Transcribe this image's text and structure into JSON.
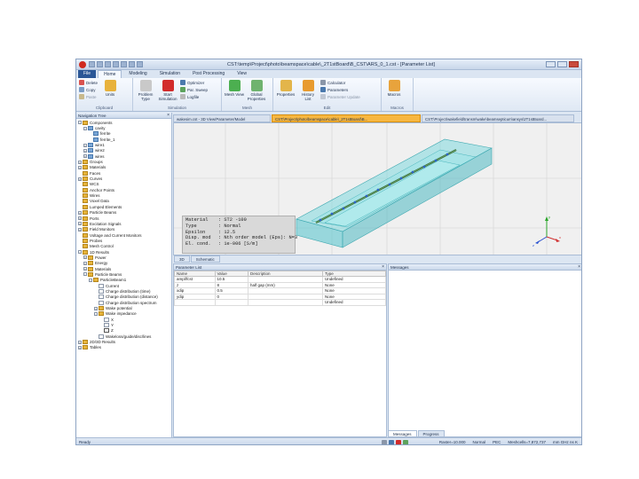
{
  "window": {
    "title": "CST:\\temp\\Project\\photo\\beamspace\\cable\\_2T1stBoard\\B_CST\\ARS_0_1.cst - [Parameter List]",
    "quick_access_icons": [
      "save-icon",
      "undo-icon",
      "redo-icon",
      "open-icon",
      "print-icon",
      "macro-icon",
      "help-icon"
    ]
  },
  "ribbon": {
    "tabs": [
      "File",
      "Home",
      "Modeling",
      "Simulation",
      "Post Processing",
      "View"
    ],
    "active_tab": "Home",
    "groups": {
      "clipboard": {
        "label": "Clipboard",
        "delete": "Delete",
        "copy": "Copy",
        "paste": "Paste",
        "units": "Units"
      },
      "simulation": {
        "label": "Simulation",
        "problem_type": "Problem Type",
        "start_simulation": "Start Simulation",
        "optimizer": "Optimizer",
        "par_sweep": "Par. Sweep",
        "logfile": "Logfile"
      },
      "mesh": {
        "label": "Mesh",
        "mesh_view": "Mesh View",
        "global_properties": "Global Properties"
      },
      "edit": {
        "label": "Edit",
        "properties": "Properties",
        "history_list": "History List",
        "calculator": "Calculator",
        "parameters": "Parameters",
        "parameter_update": "Parameter Update"
      },
      "macros": {
        "label": "Macros",
        "macros": "Macros"
      }
    }
  },
  "navigation_tree": {
    "title": "Navigation Tree",
    "items": [
      {
        "label": "Components",
        "level": 0,
        "expander": "-",
        "icon": "folder"
      },
      {
        "label": "cavity",
        "level": 1,
        "expander": "-",
        "icon": "component"
      },
      {
        "label": "ferrite",
        "level": 2,
        "expander": "",
        "icon": "solid"
      },
      {
        "label": "ferrite_1",
        "level": 2,
        "expander": "",
        "icon": "solid"
      },
      {
        "label": "wire1",
        "level": 1,
        "expander": "+",
        "icon": "component"
      },
      {
        "label": "wire2",
        "level": 1,
        "expander": "+",
        "icon": "component"
      },
      {
        "label": "wires",
        "level": 1,
        "expander": "+",
        "icon": "component"
      },
      {
        "label": "Groups",
        "level": 0,
        "expander": "+",
        "icon": "folder"
      },
      {
        "label": "Materials",
        "level": 0,
        "expander": "+",
        "icon": "folder"
      },
      {
        "label": "Faces",
        "level": 0,
        "expander": "",
        "icon": "folder"
      },
      {
        "label": "Curves",
        "level": 0,
        "expander": "+",
        "icon": "folder"
      },
      {
        "label": "WCS",
        "level": 0,
        "expander": "",
        "icon": "folder"
      },
      {
        "label": "Anchor Points",
        "level": 0,
        "expander": "",
        "icon": "folder"
      },
      {
        "label": "Wires",
        "level": 0,
        "expander": "",
        "icon": "folder"
      },
      {
        "label": "Voxel Data",
        "level": 0,
        "expander": "",
        "icon": "folder"
      },
      {
        "label": "Lumped Elements",
        "level": 0,
        "expander": "",
        "icon": "folder"
      },
      {
        "label": "Particle Beams",
        "level": 0,
        "expander": "+",
        "icon": "folder"
      },
      {
        "label": "Ports",
        "level": 0,
        "expander": "+",
        "icon": "folder"
      },
      {
        "label": "Excitation Signals",
        "level": 0,
        "expander": "+",
        "icon": "folder"
      },
      {
        "label": "Field Monitors",
        "level": 0,
        "expander": "+",
        "icon": "folder"
      },
      {
        "label": "Voltage and Current Monitors",
        "level": 0,
        "expander": "",
        "icon": "folder"
      },
      {
        "label": "Probes",
        "level": 0,
        "expander": "",
        "icon": "folder"
      },
      {
        "label": "Mesh Control",
        "level": 0,
        "expander": "",
        "icon": "folder"
      },
      {
        "label": "1D Results",
        "level": 0,
        "expander": "-",
        "icon": "folder"
      },
      {
        "label": "Power",
        "level": 1,
        "expander": "+",
        "icon": "folder"
      },
      {
        "label": "Energy",
        "level": 1,
        "expander": "+",
        "icon": "folder"
      },
      {
        "label": "Materials",
        "level": 1,
        "expander": "+",
        "icon": "folder"
      },
      {
        "label": "Particle Beams",
        "level": 1,
        "expander": "-",
        "icon": "folder"
      },
      {
        "label": "ParticleBeam1",
        "level": 2,
        "expander": "-",
        "icon": "folder"
      },
      {
        "label": "Current",
        "level": 3,
        "expander": "",
        "icon": "file"
      },
      {
        "label": "Charge distribution (time)",
        "level": 3,
        "expander": "",
        "icon": "file"
      },
      {
        "label": "Charge distribution (distance)",
        "level": 3,
        "expander": "",
        "icon": "file"
      },
      {
        "label": "Charge distribution spectrum",
        "level": 3,
        "expander": "",
        "icon": "file"
      },
      {
        "label": "Wake potential",
        "level": 3,
        "expander": "+",
        "icon": "folder"
      },
      {
        "label": "Wake impedance",
        "level": 3,
        "expander": "-",
        "icon": "folder"
      },
      {
        "label": "X",
        "level": 4,
        "expander": "",
        "icon": "file"
      },
      {
        "label": "Y",
        "level": 4,
        "expander": "",
        "icon": "file"
      },
      {
        "label": "Z",
        "level": 4,
        "expander": "",
        "icon": "selected"
      },
      {
        "label": "Wakeloss/guide/disc/lines",
        "level": 3,
        "expander": "",
        "icon": "file"
      },
      {
        "label": "2D/3D Results",
        "level": 0,
        "expander": "+",
        "icon": "folder"
      },
      {
        "label": "Tables",
        "level": 0,
        "expander": "+",
        "icon": "folder"
      }
    ]
  },
  "document_tabs": [
    "wakesim.cst - 3D View/Parameter/Model",
    "CST:\\Project\\photo\\beamspace\\cable\\_2T1stBoard\\B...",
    "CST:\\Project\\wakefield\\transm\\wake\\beamsepticum\\ansys\\2T1stBoard..."
  ],
  "active_document_tab": 1,
  "viewport": {
    "info": [
      {
        "key": "Material",
        "value": ": ST2 -100"
      },
      {
        "key": "Type",
        "value": ": Normal"
      },
      {
        "key": "Epsilon",
        "value": ": 12.5"
      },
      {
        "key": "Disp. mod",
        "value": ": Nth order model (Eps): N=3"
      },
      {
        "key": "El. cond.",
        "value": ": 1e-006 [S/m]"
      }
    ],
    "view_tabs": [
      "3D",
      "Schematic"
    ],
    "axes": {
      "x": "x",
      "y": "y",
      "z": "z"
    }
  },
  "parameter_list": {
    "title": "Parameter List",
    "columns": [
      "Name",
      "Value",
      "Description",
      "Type"
    ],
    "rows": [
      [
        "ampl/fcst",
        "10.5",
        "",
        "Undefined"
      ],
      [
        "z",
        "8",
        "half gap (mm)",
        "None"
      ],
      [
        "xdip",
        "0.5",
        "",
        "None"
      ],
      [
        "ydip",
        "0",
        "",
        "None"
      ],
      [
        "",
        "",
        "",
        "Undefined"
      ]
    ]
  },
  "messages": {
    "title": "Messages",
    "tabs": [
      "Messages",
      "Progress"
    ]
  },
  "status_bar": {
    "left": "Ready",
    "raster": "Raster=10.000",
    "normal": "Normal",
    "mode": "PEC",
    "meshcells": "Meshcells=7,872,737",
    "units": "mm GHz ns K"
  },
  "colors": {
    "accent_blue": "#2b5797",
    "active_tab": "#f7b740",
    "cavity_fill": "#5fcfd6",
    "beam_dot": "#2d64c8"
  }
}
